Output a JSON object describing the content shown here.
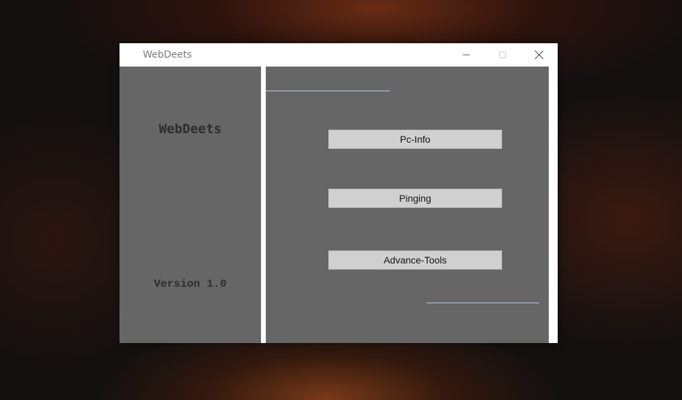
{
  "window": {
    "title": "WebDeets"
  },
  "sidebar": {
    "app_title": "WebDeets",
    "version": "Version 1.0"
  },
  "main": {
    "buttons": [
      {
        "label": "Pc-Info"
      },
      {
        "label": "Pinging"
      },
      {
        "label": "Advance-Tools"
      }
    ]
  },
  "titlebar_icons": {
    "minimize": "minimize-icon",
    "maximize": "maximize-icon",
    "close": "close-icon"
  }
}
